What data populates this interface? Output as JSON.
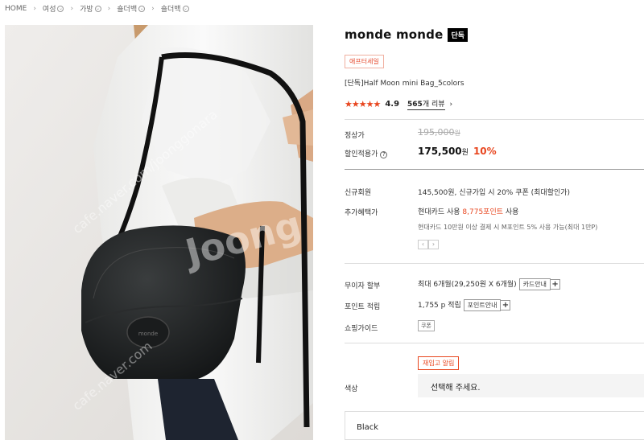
{
  "breadcrumb": [
    "HOME",
    "여성",
    "가방",
    "숄더백",
    "숄더백"
  ],
  "product": {
    "brand": "monde monde",
    "brand_badge": "단독",
    "sale_tag": "애프터세일",
    "name": "[단독]Half Moon mini Bag_5colors",
    "stars": "★★★★★",
    "rating": "4.9",
    "review_count": "565",
    "review_suffix": "개 리뷰",
    "chevron": "›"
  },
  "price": {
    "regular_label": "정상가",
    "regular_value": "195,000",
    "regular_unit": "원",
    "discount_label": "할인적용가",
    "sale_value": "175,500",
    "sale_unit": "원",
    "discount_pct": "10%"
  },
  "benefits": {
    "new_member_label": "신규회원",
    "new_member_text": "145,500원, 신규가입 시 20% 쿠폰 (최대할인가)",
    "extra_label": "추가혜택가",
    "extra_prefix": "현대카드 사용 ",
    "extra_points": "8,775포인트",
    "extra_suffix": " 사용",
    "extra_note": "현대카드 10만원 이상 결제 시 M포인트 5% 사용 가능(최대 1만P)",
    "pager_prev": "‹",
    "pager_next": "›"
  },
  "installment": {
    "label": "무이자 할부",
    "text": "최대 6개월(29,250원 X 6개월)",
    "button": "카드안내",
    "plus": "+"
  },
  "points": {
    "label": "포인트 적립",
    "text": "1,755 p 적립",
    "button": "포인트안내",
    "plus": "+"
  },
  "guide": {
    "label": "쇼핑가이드",
    "coupon": "쿠폰"
  },
  "restock": "재입고 알림",
  "color": {
    "label": "색상",
    "placeholder": "선택해 주세요.",
    "first_option": "Black"
  },
  "watermark": "Joonggonara",
  "watermark_url": "cafe.naver.com/joonggonara",
  "colors": {
    "accent": "#e8461f",
    "badge_bg": "#000000"
  }
}
